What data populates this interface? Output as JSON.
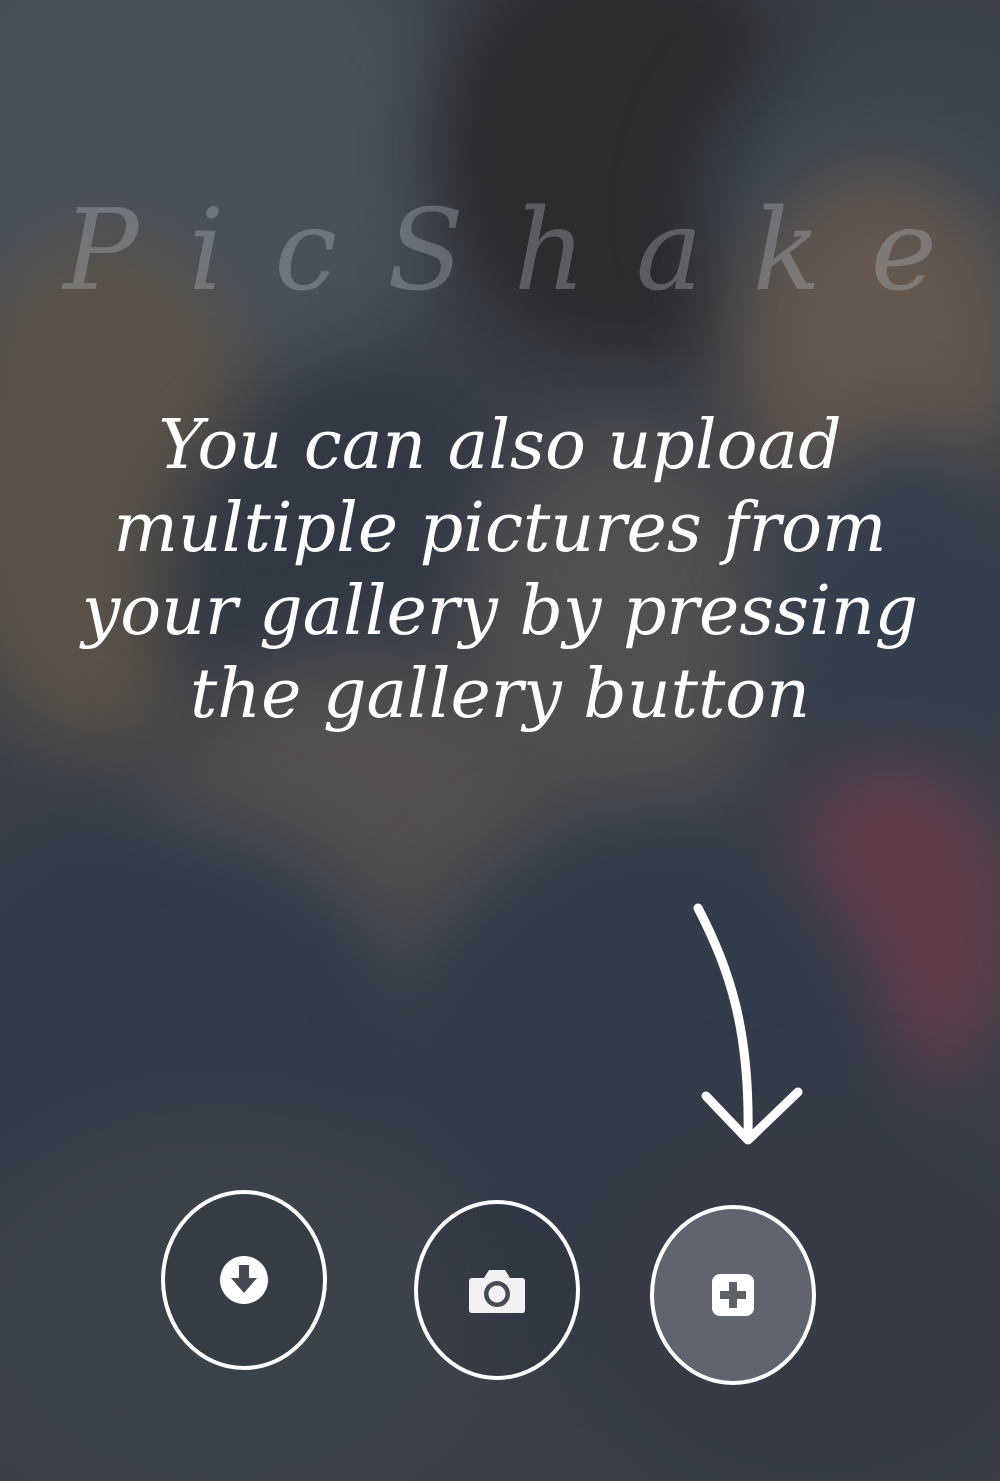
{
  "app": {
    "title": "PicShake"
  },
  "tutorial": {
    "lines": [
      "You can also upload",
      "multiple pictures from",
      "your gallery by pressing",
      "the gallery button"
    ]
  },
  "buttons": {
    "download": {
      "icon": "download-icon"
    },
    "camera": {
      "icon": "camera-icon"
    },
    "gallery": {
      "icon": "gallery-add-icon"
    }
  },
  "colors": {
    "text": "#ffffff",
    "title": "#bec3cd",
    "icon": "#ffffff"
  }
}
